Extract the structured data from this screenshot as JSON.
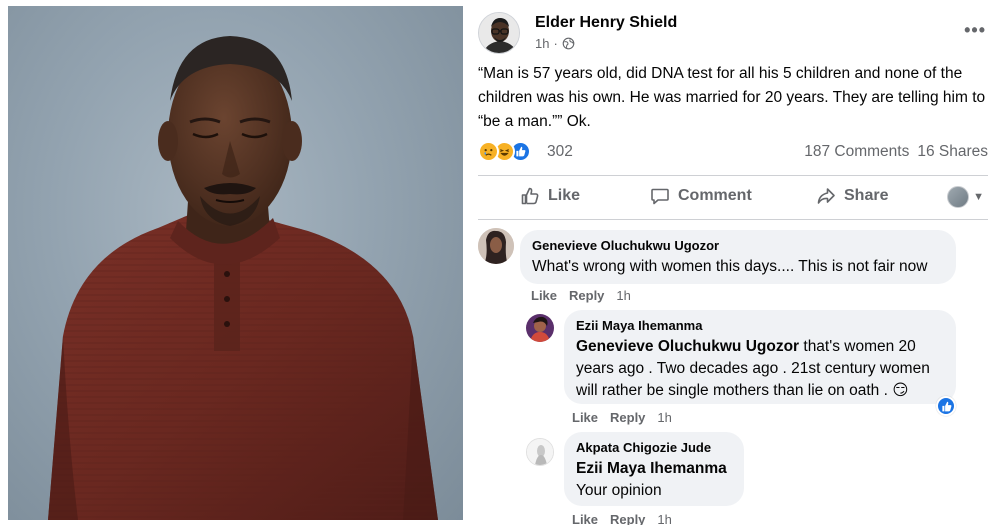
{
  "post": {
    "author": "Elder Henry Shield",
    "time": "1h",
    "text": "“Man is 57 years old, did DNA test for all his 5 children and none of the children was his own. He was married for 20 years. They are telling him to “be a man.”” Ok.",
    "reaction_count": "302",
    "comments_count": "187 Comments",
    "shares_count": "16 Shares",
    "reactions": [
      "sad",
      "haha",
      "like"
    ]
  },
  "actions": {
    "like": "Like",
    "comment": "Comment",
    "share": "Share"
  },
  "comments": [
    {
      "name": "Genevieve Oluchukwu Ugozor",
      "text": "What's wrong with women this days.... This is not fair now",
      "like": "Like",
      "reply": "Reply",
      "time": "1h"
    },
    {
      "name": "Ezii Maya Ihemanma",
      "tag": "Genevieve Oluchukwu Ugozor",
      "text": " that's women 20 years ago . Two decades ago . 21st century women will rather be single mothers than lie on oath . 😏",
      "like": "Like",
      "reply": "Reply",
      "time": "1h"
    },
    {
      "name": "Akpata Chigozie Jude",
      "tag": "Ezii Maya Ihemanma",
      "text": "Your opinion",
      "like": "Like",
      "reply": "Reply",
      "time": "1h"
    }
  ],
  "colors": {
    "accent": "#1b74e4",
    "bubble": "#f0f2f5",
    "muted": "#65676b",
    "sweater": "#6e2a22",
    "backdrop": "#93a3b0"
  },
  "icons": [
    "globe-icon",
    "more-icon",
    "like-icon",
    "comment-icon",
    "share-icon",
    "chevron-down-icon",
    "thumbs-up-icon"
  ]
}
